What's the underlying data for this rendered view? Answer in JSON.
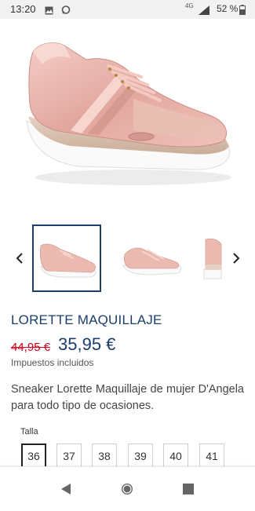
{
  "status_bar": {
    "time": "13:20",
    "network": "4G",
    "battery": "52 %",
    "icons": [
      "photo-icon",
      "chat-icon",
      "signal-icon",
      "battery-icon"
    ]
  },
  "gallery": {
    "hero_alt": "pink-sneaker-image",
    "thumbnails": [
      "sneaker-side-view",
      "sneaker-angled-view",
      "sneaker-heel-view"
    ],
    "selected_index": 0
  },
  "product": {
    "title": "LORETTE MAQUILLAJE",
    "price_old": "44,95 €",
    "price_new": "35,95 €",
    "tax_note": "Impuestos incluidos",
    "description": "Sneaker Lorette Maquillaje de mujer D'Angela para todo tipo de ocasiones."
  },
  "sizes": {
    "label": "Talla",
    "options": [
      "36",
      "37",
      "38",
      "39",
      "40",
      "41"
    ],
    "selected": "36"
  },
  "colors": {
    "accent": "#1b3e6b",
    "sale": "#d0021b",
    "product_pink": "#e8b4ae"
  }
}
